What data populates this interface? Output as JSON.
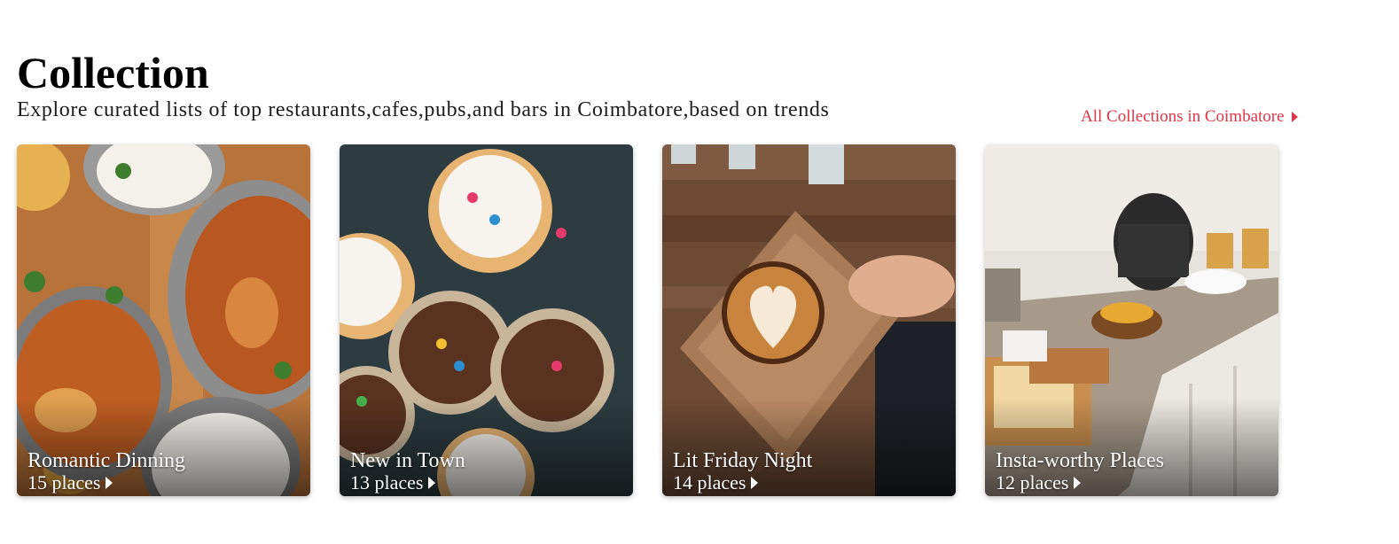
{
  "header": {
    "title": "Collection",
    "subtitle": "Explore curated lists of top restaurants,cafes,pubs,and bars in Coimbatore,based on trends",
    "all_link": "All Collections in Coimbatore"
  },
  "colors": {
    "accent": "#e03546",
    "text": "#1c1c1c"
  },
  "collections": [
    {
      "title": "Romantic Dinning",
      "places": "15 places",
      "icon": "caret-right-icon"
    },
    {
      "title": "New in Town",
      "places": "13 places",
      "icon": "caret-right-icon"
    },
    {
      "title": "Lit Friday Night",
      "places": "14 places",
      "icon": "caret-right-icon"
    },
    {
      "title": "Insta-worthy Places",
      "places": "12 places",
      "icon": "caret-right-icon"
    }
  ]
}
